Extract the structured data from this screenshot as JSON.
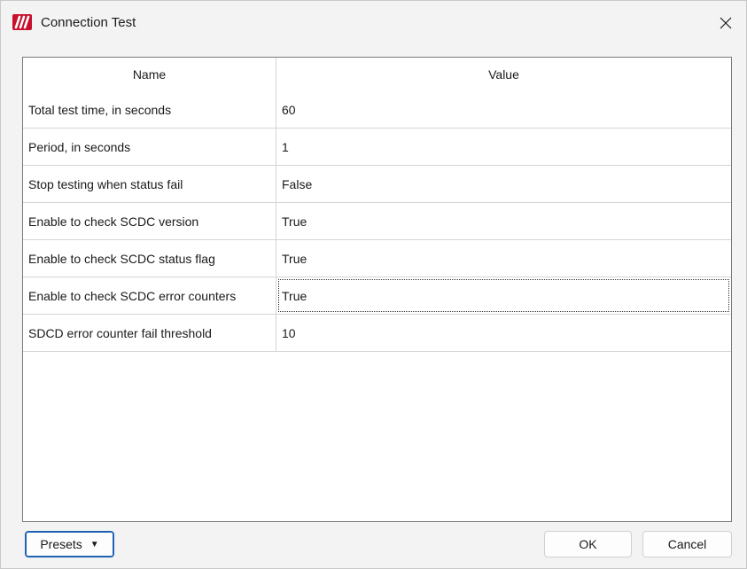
{
  "window": {
    "title": "Connection Test",
    "icon": "app-logo-icon",
    "close_icon": "close-icon",
    "accent_color": "#c8102e"
  },
  "grid": {
    "columns": {
      "name": "Name",
      "value": "Value"
    },
    "rows": [
      {
        "name": "Total test time, in seconds",
        "value": "60"
      },
      {
        "name": "Period, in seconds",
        "value": "1"
      },
      {
        "name": "Stop testing when status fail",
        "value": "False"
      },
      {
        "name": "Enable to check SCDC version",
        "value": "True"
      },
      {
        "name": "Enable to check SCDC status flag",
        "value": "True"
      },
      {
        "name": "Enable to check SCDC error counters",
        "value": "True"
      },
      {
        "name": "SDCD error counter fail threshold",
        "value": "10"
      }
    ],
    "selected_row": 5
  },
  "footer": {
    "presets_label": "Presets",
    "presets_caret": "▼",
    "ok_label": "OK",
    "cancel_label": "Cancel",
    "focus_color": "#1f62b4"
  }
}
